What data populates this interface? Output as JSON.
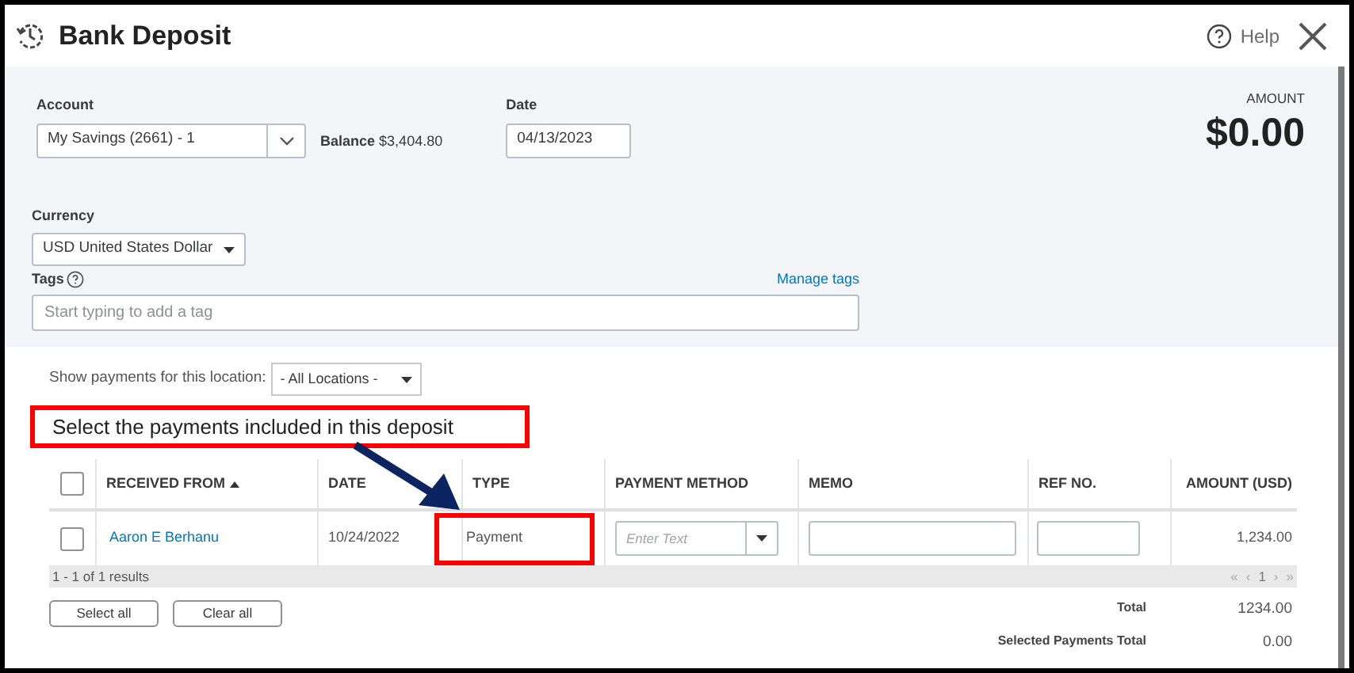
{
  "header": {
    "title": "Bank Deposit",
    "help": "Help"
  },
  "account": {
    "label": "Account",
    "value": "My Savings (2661) - 1",
    "balance_label": "Balance",
    "balance": "$3,404.80"
  },
  "date": {
    "label": "Date",
    "value": "04/13/2023"
  },
  "amount": {
    "label": "AMOUNT",
    "value": "$0.00"
  },
  "currency": {
    "label": "Currency",
    "value": "USD United States Dollar"
  },
  "tags": {
    "label": "Tags",
    "placeholder": "Start typing to add a tag",
    "manage_link": "Manage tags"
  },
  "location_filter": {
    "label": "Show payments for this location:",
    "value": "- All Locations -"
  },
  "section_heading": "Select the payments included in this deposit",
  "table": {
    "all_selected": false,
    "columns": [
      {
        "label": "RECEIVED FROM",
        "sorted": true
      },
      {
        "label": "DATE",
        "sorted": false
      },
      {
        "label": "TYPE",
        "sorted": false
      },
      {
        "label": "PAYMENT METHOD",
        "sorted": false
      },
      {
        "label": "MEMO",
        "sorted": false
      },
      {
        "label": "REF NO.",
        "sorted": false
      },
      {
        "label": "AMOUNT (USD)",
        "sorted": false
      }
    ],
    "rows": [
      {
        "selected": false,
        "received_from": "Aaron E Berhanu",
        "date": "10/24/2022",
        "type": "Payment",
        "payment_method_placeholder": "Enter Text",
        "amount": "1,234.00"
      }
    ]
  },
  "results": "1 - 1 of 1 results",
  "pagination": [
    "«",
    "‹",
    "1",
    "›",
    "»"
  ],
  "buttons": [
    "Select all",
    "Clear all"
  ],
  "totals": [
    {
      "label": "Total",
      "value": "1234.00"
    },
    {
      "label": "Selected Payments Total",
      "value": "0.00"
    }
  ]
}
